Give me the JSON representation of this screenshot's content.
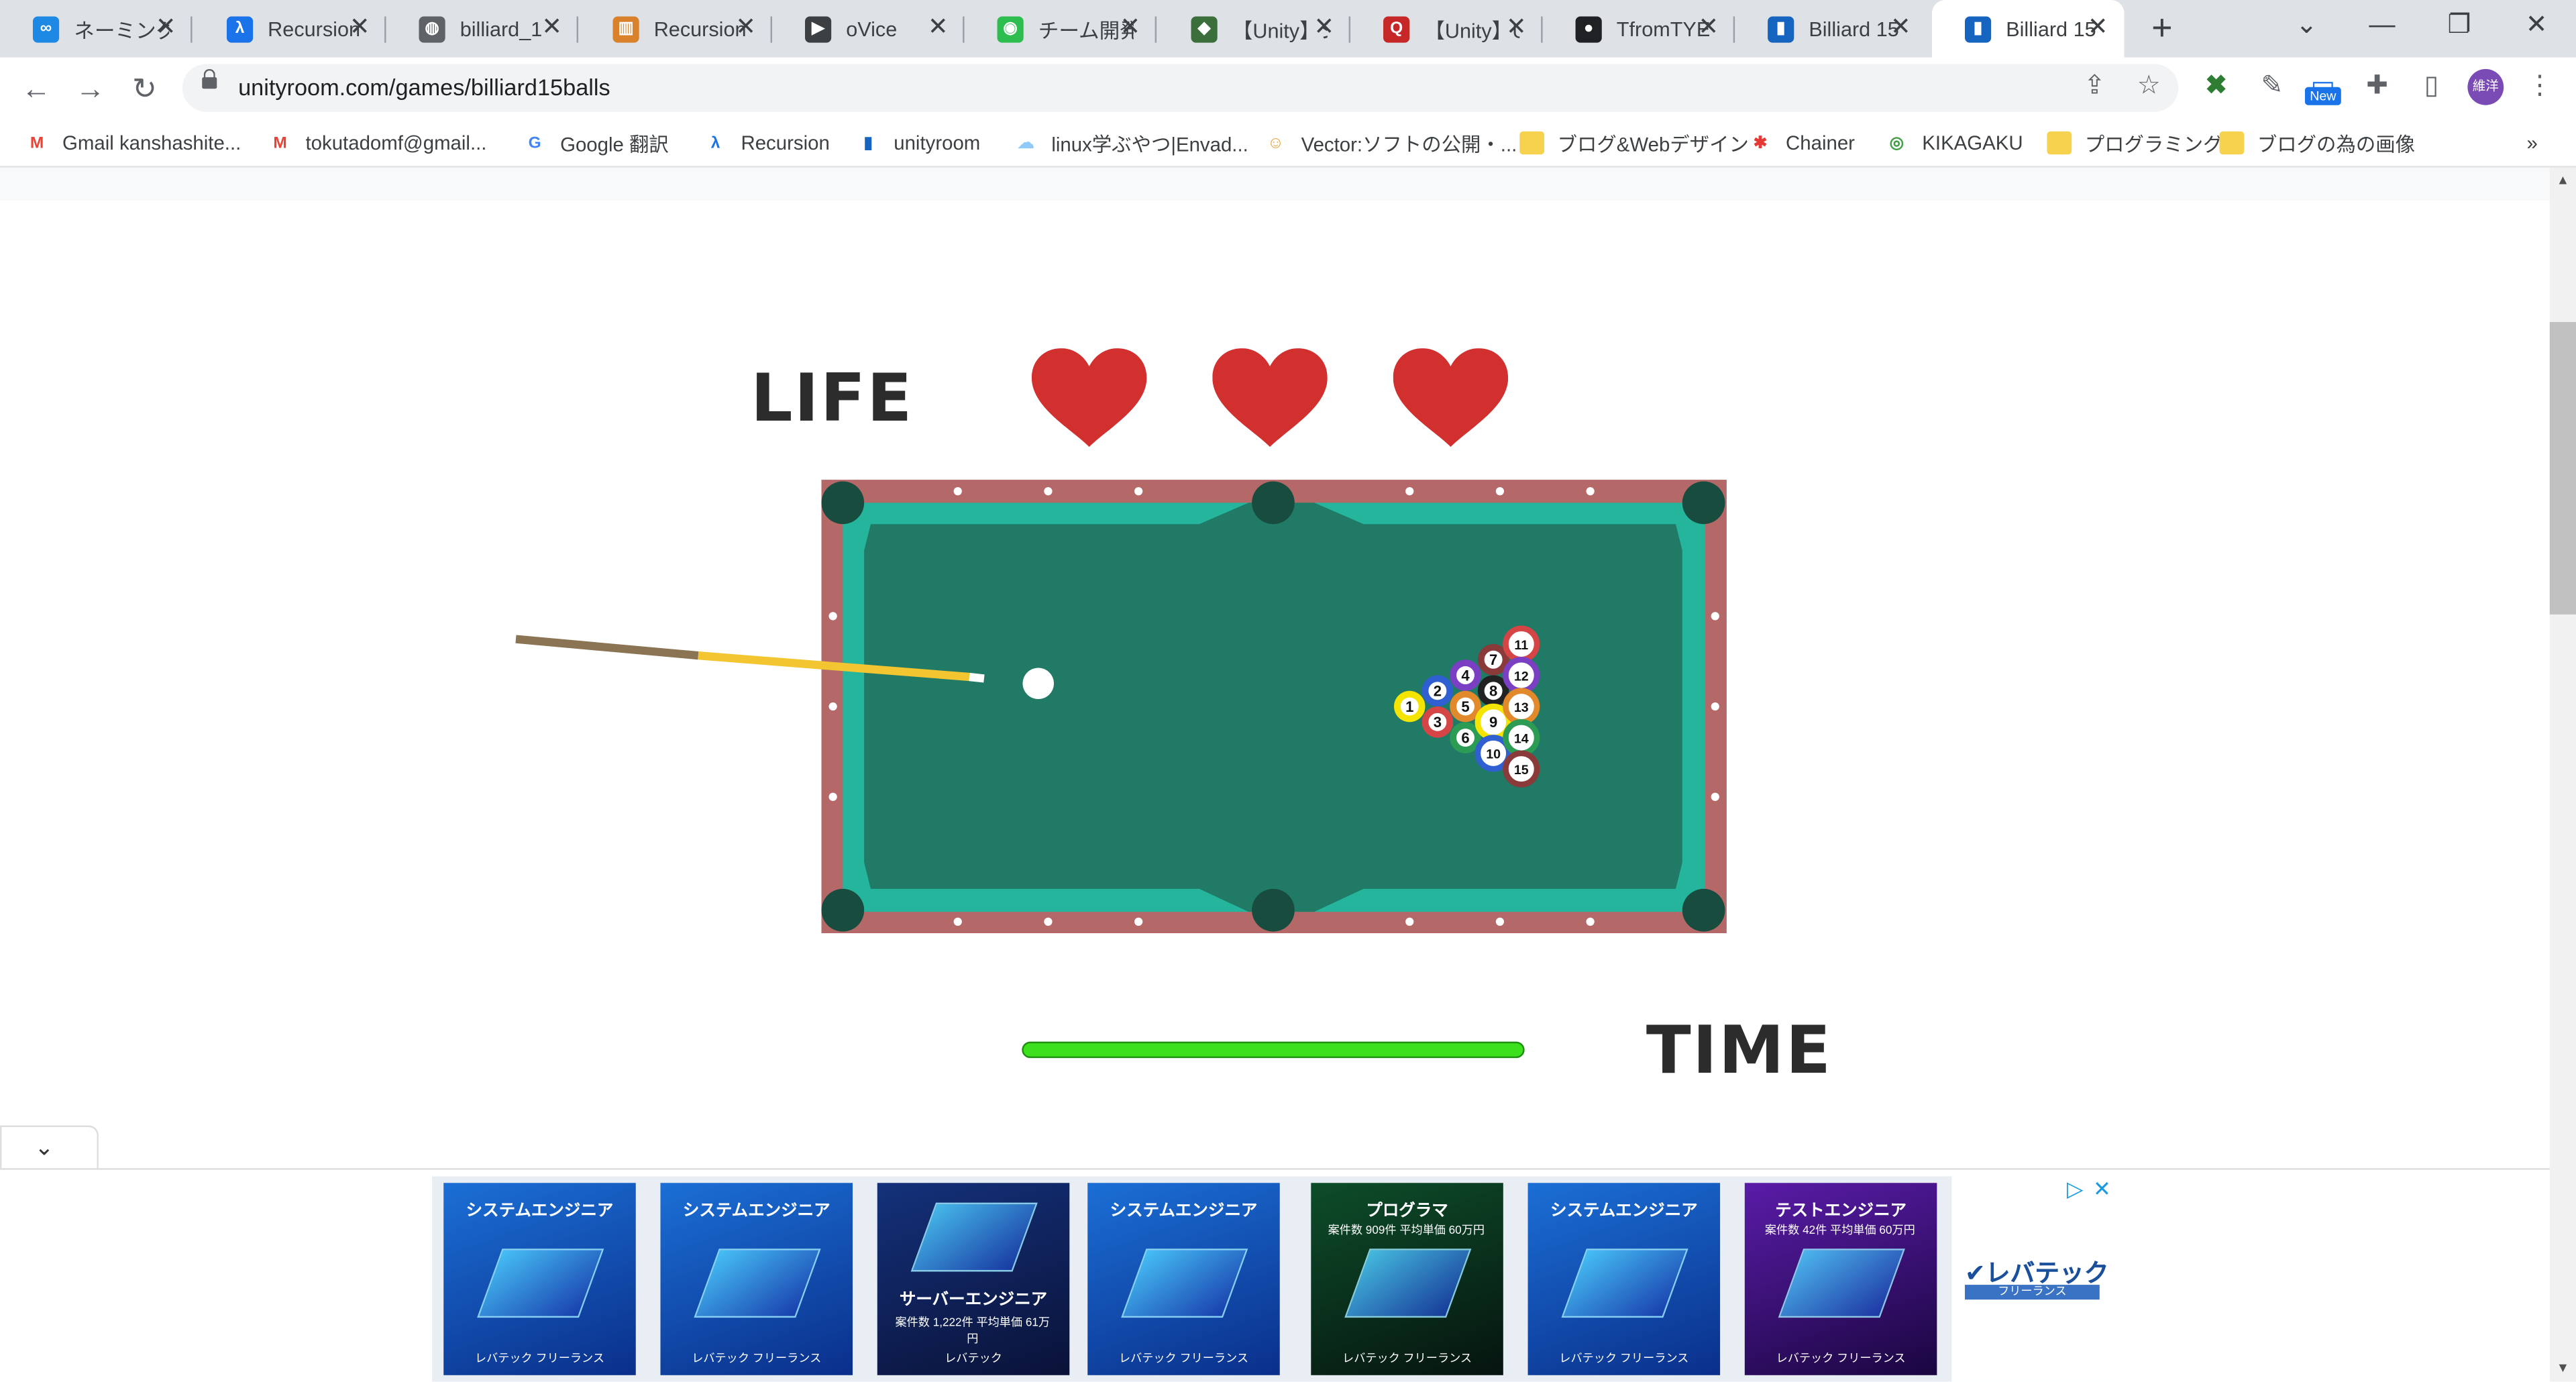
{
  "browser": {
    "tabs": [
      {
        "label": "ネーミング",
        "icon": "infinity-icon",
        "color": "#1e88e5",
        "glyph": "∞"
      },
      {
        "label": "Recursion",
        "icon": "recursion-logo-icon",
        "color": "#1a73e8",
        "glyph": "λ"
      },
      {
        "label": "billiard_1",
        "icon": "globe-icon",
        "color": "#5f6368",
        "glyph": "◍"
      },
      {
        "label": "Recursion",
        "icon": "trello-icon",
        "color": "#d9822b",
        "glyph": "▥"
      },
      {
        "label": "oVice",
        "icon": "ovice-icon",
        "color": "#3c4043",
        "glyph": "▶"
      },
      {
        "label": "チーム開発",
        "icon": "chat-icon",
        "color": "#2ebd4f",
        "glyph": "◉"
      },
      {
        "label": "【Unity】シ",
        "icon": "unity-chan-icon",
        "color": "#3b6e3b",
        "glyph": "◆"
      },
      {
        "label": "【Unity】U",
        "icon": "qiita-icon",
        "color": "#c62828",
        "glyph": "Q"
      },
      {
        "label": "TfromTYE",
        "icon": "github-icon",
        "color": "#202124",
        "glyph": "●"
      },
      {
        "label": "Billiard 15",
        "icon": "unityroom-icon",
        "color": "#1565c0",
        "glyph": "▮"
      },
      {
        "label": "Billiard 15",
        "icon": "unityroom-icon",
        "color": "#1565c0",
        "glyph": "▮"
      }
    ],
    "url": "unityroom.com/games/billiard15balls",
    "new_badge": "New",
    "avatar_text": "維洋",
    "bookmarks": [
      {
        "label": "Gmail kanshashite...",
        "icon": "gmail-icon",
        "glyph": "M",
        "color": "#ea4335"
      },
      {
        "label": "tokutadomf@gmail...",
        "icon": "gmail-icon",
        "glyph": "M",
        "color": "#ea4335"
      },
      {
        "label": "Google 翻訳",
        "icon": "google-translate-icon",
        "glyph": "G",
        "color": "#4285f4"
      },
      {
        "label": "Recursion",
        "icon": "recursion-logo-icon",
        "glyph": "λ",
        "color": "#1a73e8"
      },
      {
        "label": "unityroom",
        "icon": "unityroom-icon",
        "glyph": "▮",
        "color": "#1565c0"
      },
      {
        "label": "linux学ぶやつ|Envad...",
        "icon": "cloud-icon",
        "glyph": "☁",
        "color": "#90caf9"
      },
      {
        "label": "Vector:ソフトの公開・...",
        "icon": "vector-cat-icon",
        "glyph": "☺",
        "color": "#e6a23c"
      },
      {
        "label": "ブログ&Webデザイン",
        "icon": "folder-icon",
        "glyph": "",
        "color": "#f6d24e"
      },
      {
        "label": "Chainer",
        "icon": "chainer-icon",
        "glyph": "✱",
        "color": "#e53935"
      },
      {
        "label": "KIKAGAKU",
        "icon": "kikagaku-icon",
        "glyph": "◎",
        "color": "#43a047"
      },
      {
        "label": "プログラミング",
        "icon": "folder-icon",
        "glyph": "",
        "color": "#f6d24e"
      },
      {
        "label": "ブログの為の画像",
        "icon": "folder-icon",
        "glyph": "",
        "color": "#f6d24e"
      }
    ],
    "more_bookmarks": "»"
  },
  "game": {
    "life_label": "LIFE",
    "time_label": "TIME",
    "lives": 3,
    "time_remaining_fraction": 1.0,
    "colors": {
      "felt": "#207a66",
      "cushion": "#25b59c",
      "rail": "#b46868",
      "pocket": "#174c3e",
      "heart": "#d22f2f",
      "time_bar": "#3de01d",
      "cue_tip": "#ffffff",
      "cue_shaft": "#f3c531",
      "cue_butt": "#8b7453"
    },
    "balls": [
      {
        "n": "1",
        "color": "#f5e300"
      },
      {
        "n": "2",
        "color": "#2f5fd1"
      },
      {
        "n": "3",
        "color": "#d64545"
      },
      {
        "n": "4",
        "color": "#7b3fc4"
      },
      {
        "n": "5",
        "color": "#e2892b"
      },
      {
        "n": "6",
        "color": "#2c9c54"
      },
      {
        "n": "7",
        "color": "#8b3a3a"
      },
      {
        "n": "8",
        "color": "#222222"
      },
      {
        "n": "9",
        "color": "#f5e300"
      },
      {
        "n": "10",
        "color": "#2f5fd1"
      },
      {
        "n": "11",
        "color": "#d64545"
      },
      {
        "n": "12",
        "color": "#7b3fc4"
      },
      {
        "n": "13",
        "color": "#e2892b"
      },
      {
        "n": "14",
        "color": "#2c9c54"
      },
      {
        "n": "15",
        "color": "#8b3a3a"
      }
    ]
  },
  "ads": [
    {
      "title": "システムエンジニア",
      "theme": "blue",
      "sub": "",
      "logo": "レバテック フリーランス"
    },
    {
      "title": "システムエンジニア",
      "theme": "blue",
      "sub": "",
      "logo": "レバテック フリーランス"
    },
    {
      "title": "サーバーエンジニア",
      "theme": "dark",
      "sub": "案件数 1,222件 平均単価 61万円",
      "logo": "レバテック"
    },
    {
      "title": "システムエンジニア",
      "theme": "blue",
      "sub": "",
      "logo": "レバテック フリーランス"
    },
    {
      "title": "プログラマ",
      "theme": "green",
      "sub": "案件数 909件 平均単価 60万円",
      "logo": "レバテック フリーランス"
    },
    {
      "title": "システムエンジニア",
      "theme": "blue",
      "sub": "",
      "logo": "レバテック フリーランス"
    },
    {
      "title": "テストエンジニア",
      "theme": "purple",
      "sub": "案件数 42件 平均単価 60万円",
      "logo": "レバテック フリーランス"
    }
  ],
  "ad_brand": {
    "name": "✔レバテック",
    "sub": "フリーランス",
    "adchoices": "▷",
    "close": "✕"
  }
}
